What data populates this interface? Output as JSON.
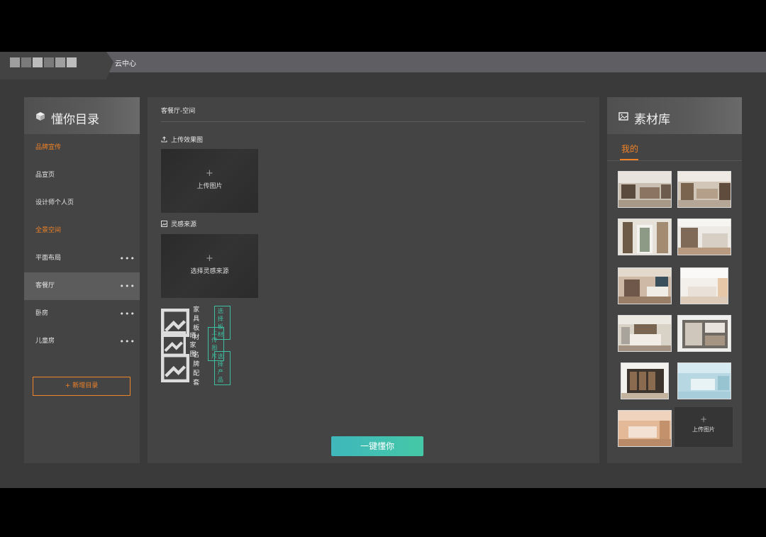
{
  "topbar": {
    "title": "云中心"
  },
  "left_panel": {
    "title": "懂你目录",
    "items": [
      {
        "label": "品牌宣传",
        "accent": true,
        "more": ""
      },
      {
        "label": "品宣页",
        "accent": false,
        "more": ""
      },
      {
        "label": "设计师个人页",
        "accent": false,
        "more": ""
      },
      {
        "label": "全景空间",
        "accent": true,
        "more": ""
      },
      {
        "label": "平面布局",
        "accent": false,
        "more": "•••"
      },
      {
        "label": "客餐厅",
        "accent": false,
        "more": "•••",
        "active": true
      },
      {
        "label": "卧房",
        "accent": false,
        "more": "•••"
      },
      {
        "label": "儿童房",
        "accent": false,
        "more": "•••"
      }
    ],
    "add_button": "+ 新增目录"
  },
  "center": {
    "breadcrumb": "客餐厅-空间",
    "upload_render_label": "上传效果图",
    "upload_render_box": {
      "plus": "+",
      "text": "上传图片"
    },
    "inspiration_label": "灵感来源",
    "inspiration_box": {
      "plus": "+",
      "text": "选择灵感来源"
    },
    "options": [
      {
        "label": "家具板材",
        "button": "选择板材"
      },
      {
        "label": "晒家图",
        "button": "上传图片"
      },
      {
        "label": "名牌配套",
        "button": "选择产品"
      }
    ],
    "primary_button": "一键懂你"
  },
  "right_panel": {
    "title": "素材库",
    "tab_mine": "我的",
    "thumbnails": [
      "living-room-render",
      "living-room-wide-render",
      "hallway-render",
      "kitchen-render",
      "bedroom-render",
      "bright-bedroom-render",
      "master-bedroom-render",
      "bathroom-topdown-render",
      "wardrobe-render",
      "blue-room-render",
      "warm-bedroom-render"
    ],
    "upload_tile": {
      "plus": "+",
      "text": "上传图片"
    }
  },
  "colors": {
    "accent": "#f08228",
    "teal": "#3fbfa2",
    "panel": "#444444",
    "bg": "#3a3a3a"
  }
}
